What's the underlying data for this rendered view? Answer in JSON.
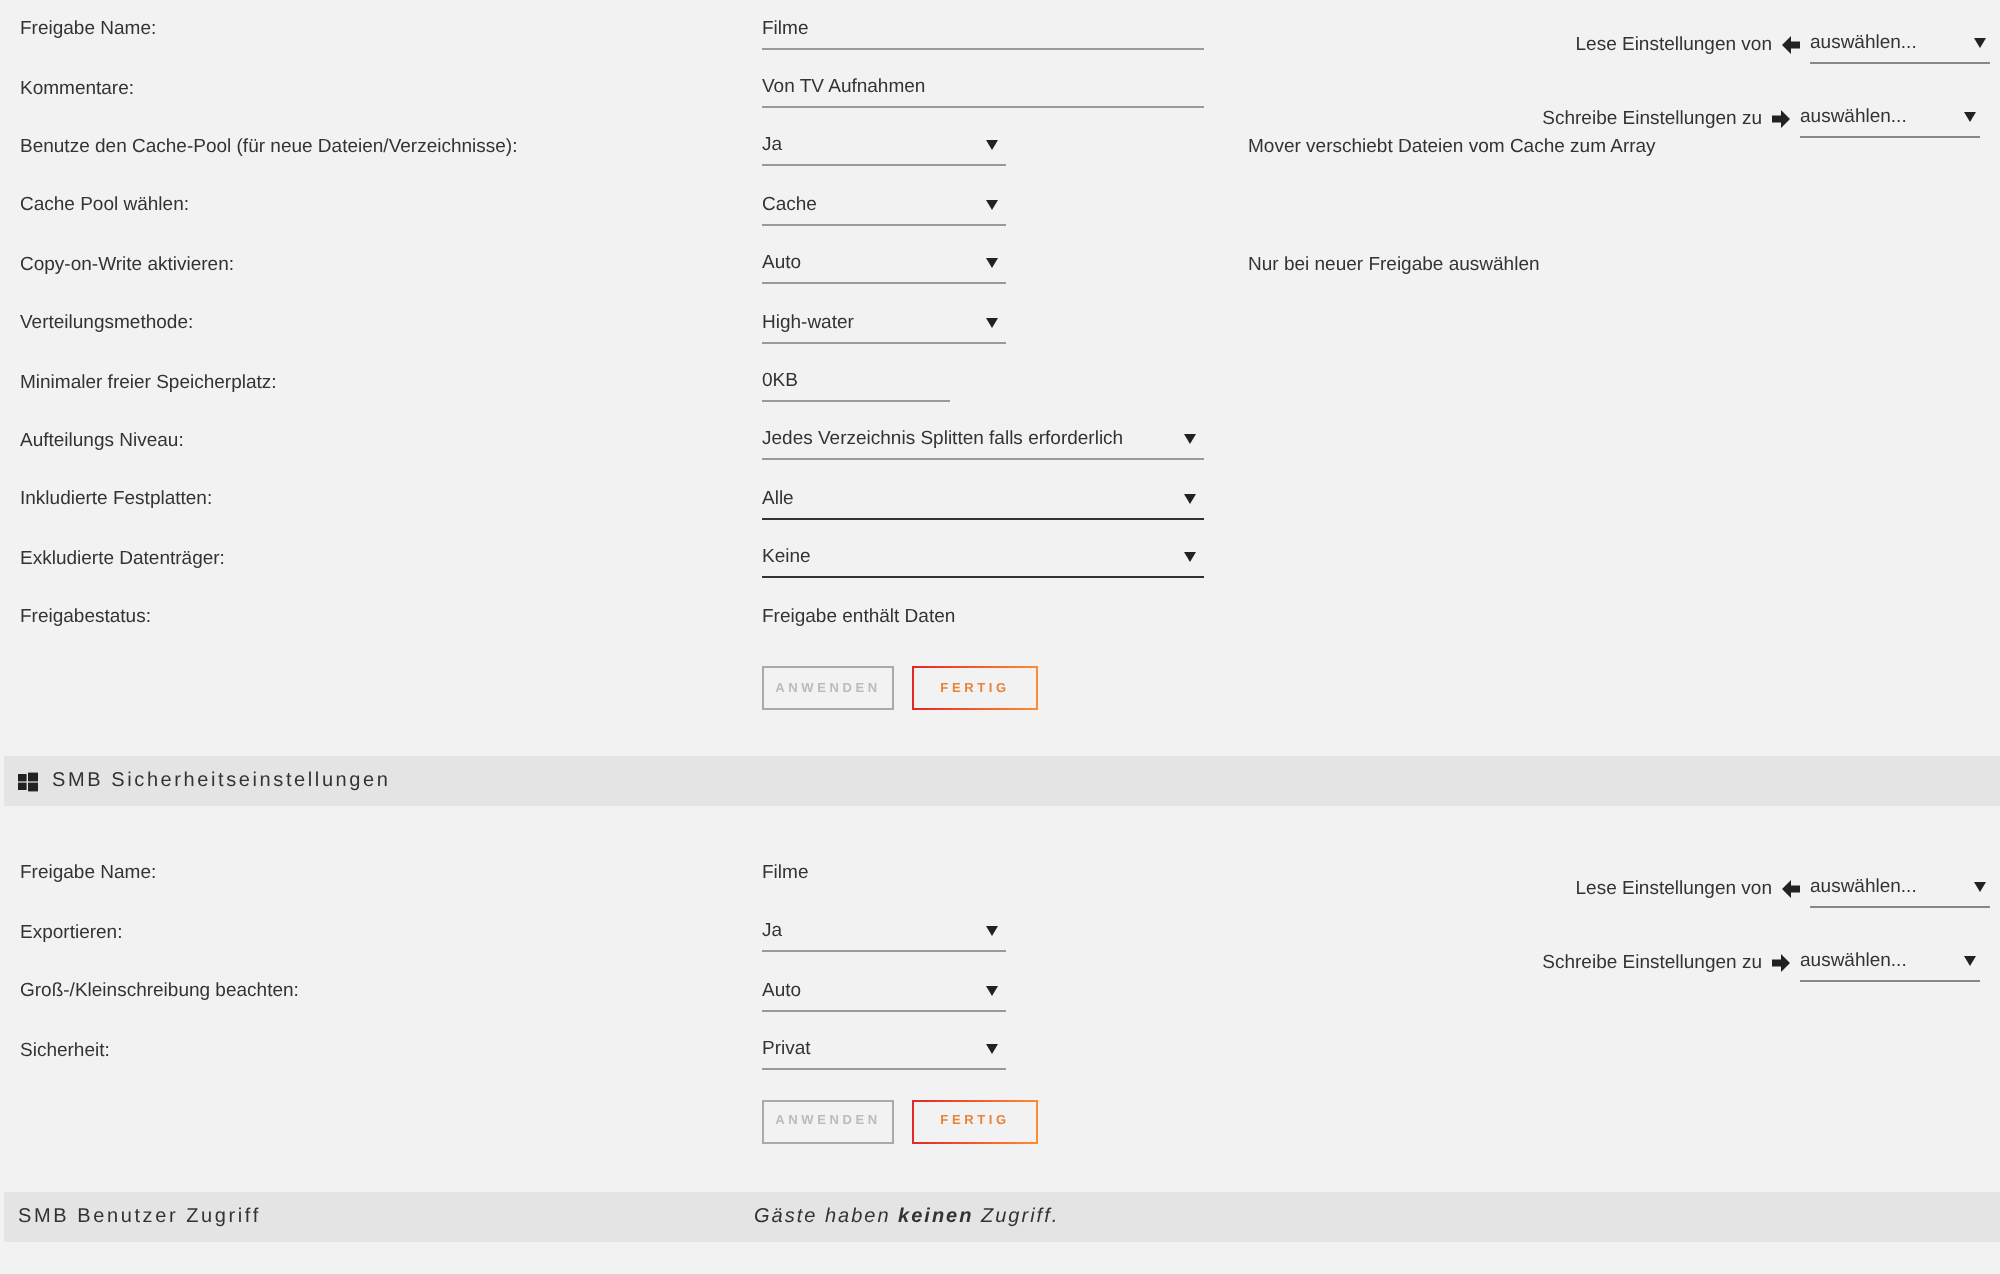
{
  "share_section": {
    "copy_settings": [
      {
        "kind": "read",
        "label": "Lese Einstellungen von",
        "value": "auswählen..."
      },
      {
        "kind": "write",
        "label": "Schreibe Einstellungen zu",
        "value": "auswählen..."
      }
    ],
    "fields": [
      {
        "label": "Freigabe Name:",
        "kind": "text",
        "value": "Filme"
      },
      {
        "label": "Kommentare:",
        "kind": "text",
        "value": "Von TV Aufnahmen"
      },
      {
        "label": "Benutze den Cache-Pool (für neue Dateien/Verzeichnisse):",
        "kind": "select",
        "value": "Ja",
        "note": "Mover verschiebt Dateien vom Cache zum Array"
      },
      {
        "label": "Cache Pool wählen:",
        "kind": "select",
        "value": "Cache"
      },
      {
        "label": "Copy-on-Write aktivieren:",
        "kind": "select",
        "value": "Auto",
        "note": "Nur bei neuer Freigabe auswählen"
      },
      {
        "label": "Verteilungsmethode:",
        "kind": "select",
        "value": "High-water"
      },
      {
        "label": "Minimaler freier Speicherplatz:",
        "kind": "shorttext",
        "value": "0KB"
      },
      {
        "label": "Aufteilungs Niveau:",
        "kind": "wideselect",
        "value": "Jedes Verzeichnis Splitten falls erforderlich"
      },
      {
        "label": "Inkludierte Festplatten:",
        "kind": "multiselect",
        "value": "Alle"
      },
      {
        "label": "Exkludierte Datenträger:",
        "kind": "multiselect",
        "value": "Keine"
      },
      {
        "label": "Freigabestatus:",
        "kind": "static",
        "value": "Freigabe enthält Daten"
      }
    ],
    "buttons": [
      {
        "label": "ANWENDEN",
        "disabled": true
      },
      {
        "label": "FERTIG",
        "disabled": false
      }
    ]
  },
  "smb_security": {
    "title": "SMB Sicherheitseinstellungen",
    "copy_settings": [
      {
        "kind": "read",
        "label": "Lese Einstellungen von",
        "value": "auswählen..."
      },
      {
        "kind": "write",
        "label": "Schreibe Einstellungen zu",
        "value": "auswählen..."
      }
    ],
    "fields": [
      {
        "label": "Freigabe Name:",
        "kind": "static",
        "value": "Filme"
      },
      {
        "label": "Exportieren:",
        "kind": "select",
        "value": "Ja"
      },
      {
        "label": "Groß-/Kleinschreibung beachten:",
        "kind": "select",
        "value": "Auto"
      },
      {
        "label": "Sicherheit:",
        "kind": "select",
        "value": "Privat"
      }
    ],
    "buttons": [
      {
        "label": "ANWENDEN",
        "disabled": true
      },
      {
        "label": "FERTIG",
        "disabled": false
      }
    ]
  },
  "smb_user_access": {
    "title": "SMB Benutzer Zugriff",
    "message": "Gäste haben **keinen** Zugriff."
  }
}
